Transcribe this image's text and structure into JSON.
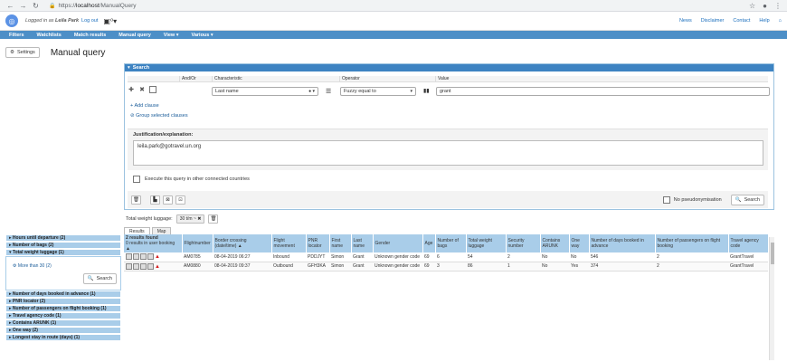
{
  "browser": {
    "protocol": "https://",
    "host": "localhost",
    "path": "/ManualQuery"
  },
  "header": {
    "logged_in_prefix": "Logged in as",
    "user_name": "Leila Park",
    "logout": "Log out",
    "links": [
      "News",
      "Disclaimer",
      "Contact",
      "Help"
    ]
  },
  "nav": [
    "Filters",
    "Watchlists",
    "Match results",
    "Manual query",
    "View ▾",
    "Various ▾"
  ],
  "page": {
    "settings_label": "Settings",
    "title": "Manual query"
  },
  "search": {
    "panel_title": "Search",
    "columns": [
      "And/Or",
      "Characteristic",
      "Operator",
      "Value"
    ],
    "characteristic": "Last name",
    "operator": "Fuzzy equal to",
    "value": "grant",
    "add_clause": "Add clause",
    "group_clauses": "Group selected clauses",
    "justification_label": "Justification/explanation:",
    "justification_text": "leila.park@gotravel.un.org",
    "execute_connected": "Execute this query in other connected countries",
    "no_pseudonymisation": "No pseudonymisation",
    "search_button": "Search"
  },
  "filter_chip": {
    "label": "Total weight luggage:",
    "value": "30 t/m ~"
  },
  "tabs": [
    "Results",
    "Map"
  ],
  "facets": [
    "Hours until departure (2)",
    "Number of bags (2)",
    "Total weight luggage (1)",
    "Number of days booked in advance (1)",
    "PNR locator (2)",
    "Number of passengers on flight booking (1)",
    "Travel agency code (1)",
    "Contains ARUNK (1)",
    "One way (2)",
    "Longest stay in route (days) (1)"
  ],
  "facet_open": {
    "option": "More than 30 (2)",
    "button": "Search"
  },
  "results": {
    "found_line1": "2 results found",
    "found_line2": "0 results in user booking ▲",
    "headers": [
      "Flightnumber",
      "Border crossing (date/time) ▲",
      "Flight movement",
      "PNR locator",
      "First name",
      "Last name",
      "Gender",
      "Age",
      "Number of bags",
      "Total weight luggage",
      "Security number",
      "Contains ARUNK",
      "One way",
      "Number of days booked in advance",
      "Number of passengers on flight booking",
      "Travel agency code"
    ],
    "rows": [
      [
        "AM0785",
        "08-04-2019 06:27",
        "Inbound",
        "PDDJYT",
        "Simon",
        "Grant",
        "Unknown gender code",
        "69",
        "6",
        "54",
        "2",
        "No",
        "No",
        "546",
        "2",
        "GrantTravel"
      ],
      [
        "AM0880",
        "08-04-2019 09:37",
        "Outbound",
        "GFH3KA",
        "Simon",
        "Grant",
        "Unknown gender code",
        "69",
        "3",
        "86",
        "1",
        "No",
        "Yes",
        "374",
        "2",
        "GrantTravel"
      ]
    ]
  }
}
